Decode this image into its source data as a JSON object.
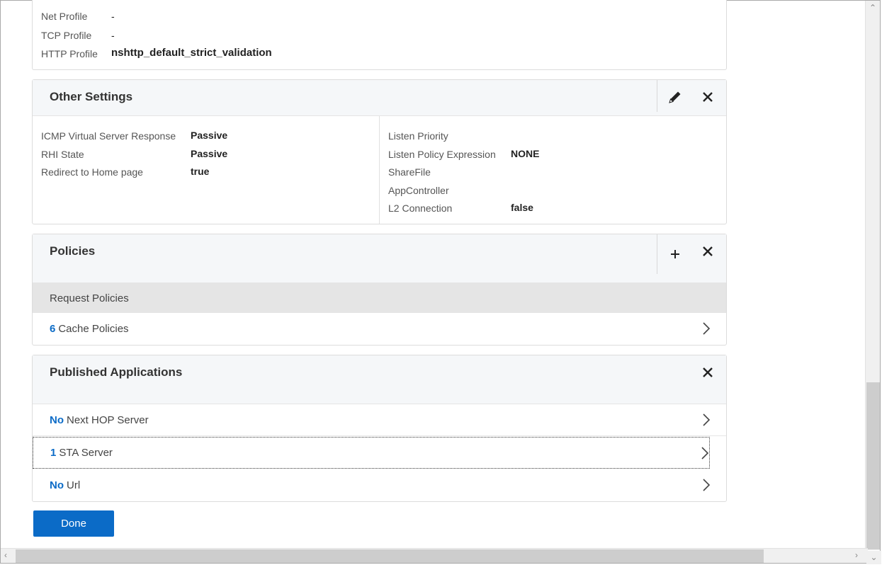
{
  "basic_settings": {
    "rows": [
      {
        "label": "Net Profile",
        "value": "-"
      },
      {
        "label": "TCP Profile",
        "value": "-"
      },
      {
        "label": "HTTP Profile",
        "value": "nshttp_default_strict_validation"
      }
    ]
  },
  "other_settings": {
    "title": "Other Settings",
    "left": [
      {
        "label": "ICMP Virtual Server Response",
        "value": "Passive"
      },
      {
        "label": "RHI State",
        "value": "Passive"
      },
      {
        "label": "Redirect to Home page",
        "value": "true"
      }
    ],
    "right": [
      {
        "label": "Listen Priority",
        "value": ""
      },
      {
        "label": "Listen Policy Expression",
        "value": "NONE"
      },
      {
        "label": "ShareFile",
        "value": ""
      },
      {
        "label": "AppController",
        "value": ""
      },
      {
        "label": "L2 Connection",
        "value": "false"
      }
    ]
  },
  "policies": {
    "title": "Policies",
    "group_label": "Request Policies",
    "items": [
      {
        "count": "6",
        "label": "Cache Policies"
      }
    ]
  },
  "published_applications": {
    "title": "Published Applications",
    "items": [
      {
        "count": "No",
        "label": "Next HOP Server"
      },
      {
        "count": "1",
        "label": "STA Server"
      },
      {
        "count": "No",
        "label": "Url"
      }
    ]
  },
  "done_label": "Done",
  "colors": {
    "accent": "#0b6bc7",
    "header_bg": "#f5f7f9",
    "group_bg": "#e5e5e5"
  },
  "icons": [
    "pencil-icon",
    "close-icon",
    "plus-icon",
    "chevron-right-icon"
  ]
}
